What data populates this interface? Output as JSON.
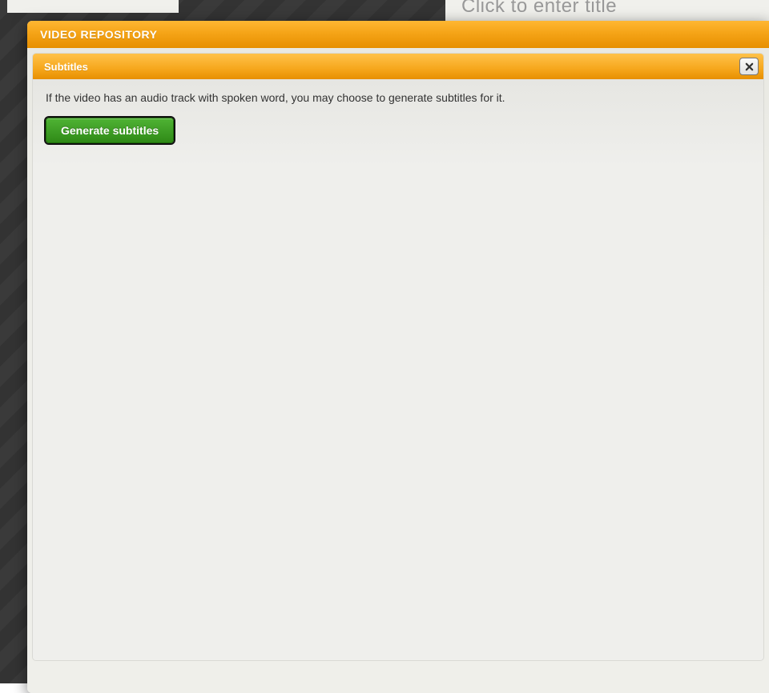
{
  "background": {
    "title_placeholder": "Click to enter title"
  },
  "modal": {
    "title": "VIDEO REPOSITORY",
    "panel": {
      "title": "Subtitles",
      "info": "If the video has an audio track with spoken word, you may choose to generate subtitles for it.",
      "generate_label": "Generate subtitles",
      "close_icon": "close-icon"
    }
  }
}
